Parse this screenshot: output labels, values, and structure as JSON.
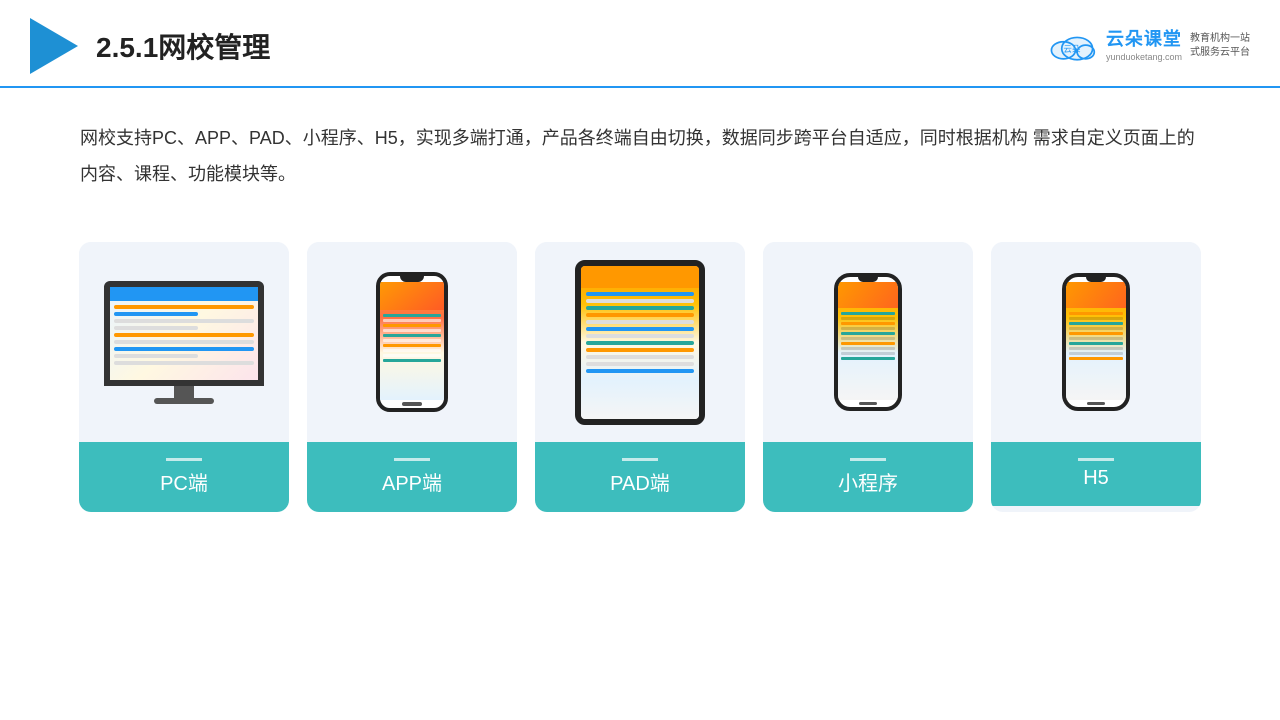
{
  "header": {
    "title": "2.5.1网校管理",
    "brand_name": "云朵课堂",
    "brand_url": "yunduoketang.com",
    "brand_slogan": "教育机构一站\n式服务云平台"
  },
  "description": "网校支持PC、APP、PAD、小程序、H5，实现多端打通，产品各终端自由切换，数据同步跨平台自适应，同时根据机构\n需求自定义页面上的内容、课程、功能模块等。",
  "cards": [
    {
      "id": "pc",
      "label": "PC端"
    },
    {
      "id": "app",
      "label": "APP端"
    },
    {
      "id": "pad",
      "label": "PAD端"
    },
    {
      "id": "miniprogram",
      "label": "小程序"
    },
    {
      "id": "h5",
      "label": "H5"
    }
  ],
  "colors": {
    "accent": "#2196f3",
    "teal": "#3dbdbd",
    "header_border": "#2196f3"
  }
}
